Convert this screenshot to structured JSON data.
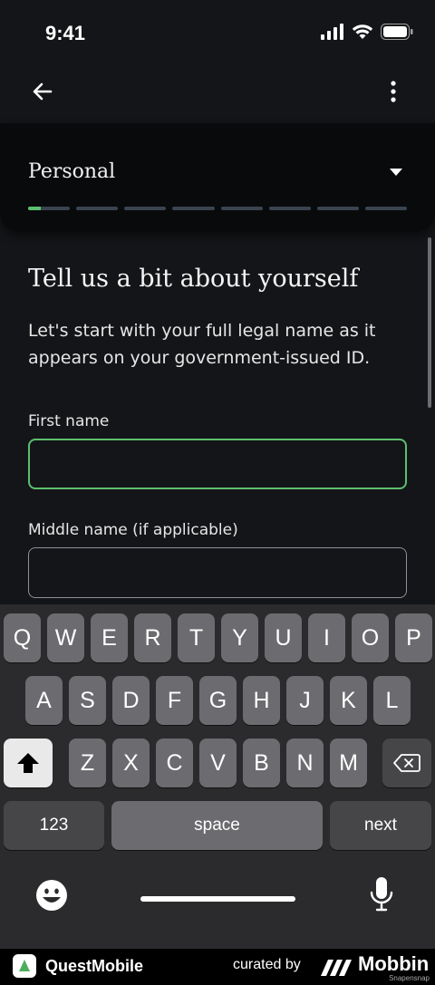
{
  "status_bar": {
    "time": "9:41"
  },
  "section": {
    "title": "Personal",
    "steps_total": 8,
    "current_step_progress": 0.3
  },
  "form": {
    "heading": "Tell us a bit about yourself",
    "intro": "Let's start with your full legal name as it appears on your government-issued ID.",
    "first_name_label": "First name",
    "first_name_value": "",
    "middle_name_label": "Middle name (if applicable)",
    "middle_name_value": ""
  },
  "keyboard": {
    "row1": [
      "Q",
      "W",
      "E",
      "R",
      "T",
      "Y",
      "U",
      "I",
      "O",
      "P"
    ],
    "row2": [
      "A",
      "S",
      "D",
      "F",
      "G",
      "H",
      "J",
      "K",
      "L"
    ],
    "row3": [
      "Z",
      "X",
      "C",
      "V",
      "B",
      "N",
      "M"
    ],
    "numbers_key": "123",
    "space_key": "space",
    "return_key": "next"
  },
  "footer": {
    "brand": "QuestMobile",
    "curated_by": "curated by",
    "curator": "Mobbin",
    "watermark": "Snapensnap"
  },
  "colors": {
    "accent": "#5cbf6e",
    "background": "#141518",
    "card": "#090a0c"
  }
}
